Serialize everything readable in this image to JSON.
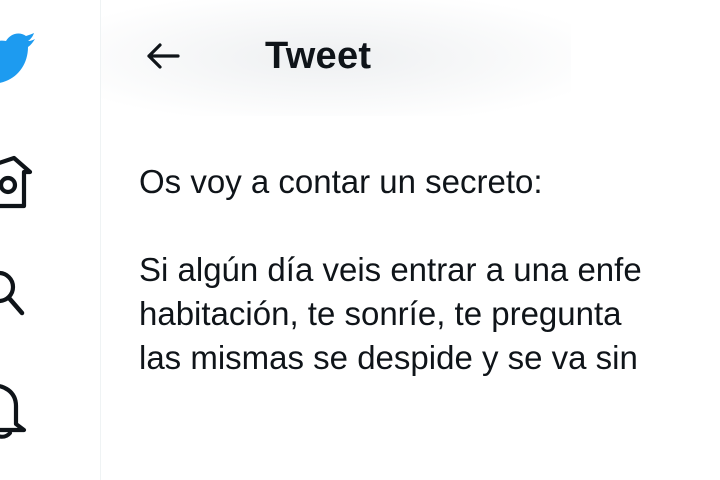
{
  "sidebar": {
    "items": [
      {
        "name": "twitter-bird-icon",
        "color": "#1d9bf0"
      },
      {
        "name": "home-icon"
      },
      {
        "name": "search-icon"
      },
      {
        "name": "notifications-icon"
      }
    ]
  },
  "header": {
    "back_icon": "arrow-left-icon",
    "title": "Tweet"
  },
  "tweet": {
    "lines": [
      "Os voy a contar un secreto:",
      "Si algún día veis entrar a una enfe",
      "habitación, te sonríe, te pregunta",
      "las mismas se despide y se va sin"
    ]
  },
  "colors": {
    "brand": "#1d9bf0",
    "text": "#0f1419",
    "divider": "#eff3f4"
  }
}
